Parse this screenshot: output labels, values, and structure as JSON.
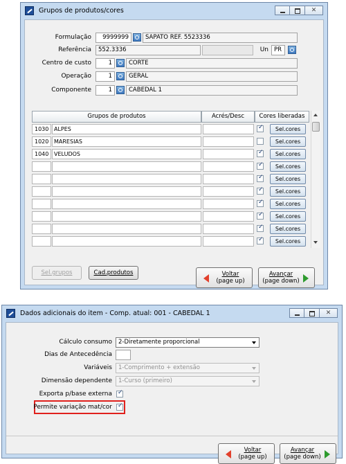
{
  "win1": {
    "title": "Grupos de produtos/cores",
    "close_glyph": "✕",
    "fields": {
      "formulacao": {
        "label": "Formulação",
        "code": "9999999",
        "desc": "SAPATO REF. 5523336"
      },
      "referencia": {
        "label": "Referência",
        "value": "552.3336",
        "un_label": "Un",
        "un_value": "PR"
      },
      "centro": {
        "label": "Centro de custo",
        "code": "1",
        "desc": "CORTE"
      },
      "operacao": {
        "label": "Operação",
        "code": "1",
        "desc": "GERAL"
      },
      "componente": {
        "label": "Componente",
        "code": "1",
        "desc": "CABEDAL 1"
      }
    },
    "grid": {
      "headers": {
        "grupos": "Grupos de produtos",
        "acres": "Acrés/Desc",
        "cores": "Cores liberadas"
      },
      "sel_label": "Sel.cores",
      "rows": [
        {
          "code": "1030",
          "name": "ALPES",
          "checked": true
        },
        {
          "code": "1020",
          "name": "MARESIAS",
          "checked": false
        },
        {
          "code": "1040",
          "name": "VELUDOS",
          "checked": true
        },
        {
          "code": "",
          "name": "",
          "checked": true
        },
        {
          "code": "",
          "name": "",
          "checked": true
        },
        {
          "code": "",
          "name": "",
          "checked": true
        },
        {
          "code": "",
          "name": "",
          "checked": true
        },
        {
          "code": "",
          "name": "",
          "checked": true
        },
        {
          "code": "",
          "name": "",
          "checked": true
        },
        {
          "code": "",
          "name": "",
          "checked": true
        }
      ]
    },
    "buttons": {
      "sel_grupos": "Sel.grupos",
      "cad_produtos": "Cad.produtos",
      "voltar": "Voltar",
      "voltar_sub": "(page up)",
      "avancar": "Avançar",
      "avancar_sub": "(page down)"
    }
  },
  "win2": {
    "title": "Dados adicionais do item - Comp. atual: 001  - CABEDAL 1",
    "close_glyph": "✕",
    "fields": {
      "calculo": {
        "label": "Cálculo consumo",
        "value": "2-Diretamente proporcional"
      },
      "dias": {
        "label": "Dias de Antecedência",
        "value": ""
      },
      "variaveis": {
        "label": "Variáveis",
        "value": "1-Comprimento + extensão"
      },
      "dimensao": {
        "label": "Dimensão dependente",
        "value": "1-Curso (primeiro)"
      },
      "exporta": {
        "label": "Exporta p/base externa",
        "checked": true
      },
      "permite": {
        "label": "Permite variação mat/cor",
        "checked": true
      }
    },
    "buttons": {
      "voltar": "Voltar",
      "voltar_sub": "(page up)",
      "avancar": "Avançar",
      "avancar_sub": "(page down)"
    }
  },
  "colors": {
    "title_bg": "#c5daf0",
    "client_bg": "#f0f0f0",
    "highlight": "#e0201c",
    "back_arrow": "#e2402c",
    "next_arrow": "#2e9b2e"
  }
}
